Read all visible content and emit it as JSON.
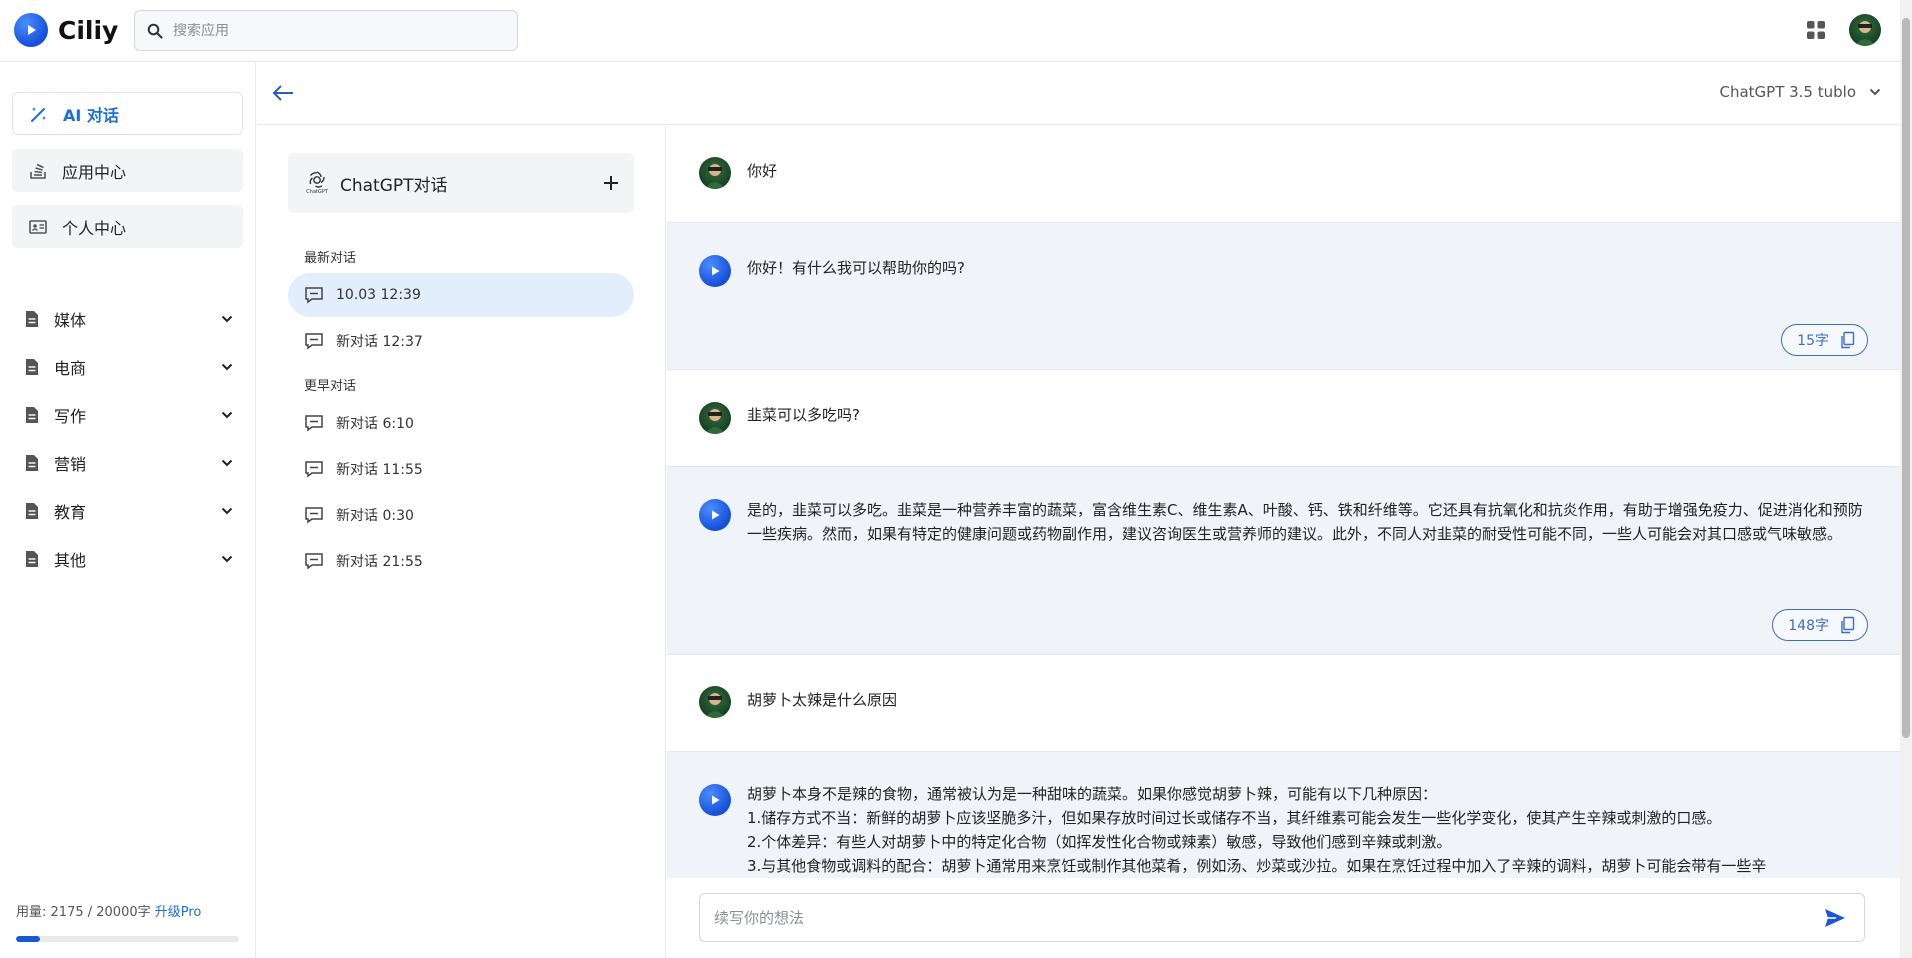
{
  "app": {
    "name": "Ciliy"
  },
  "search": {
    "placeholder": "搜索应用",
    "value": ""
  },
  "sidebar": {
    "nav": [
      {
        "label": "AI 对话",
        "icon": "magic-wand-icon",
        "active": true
      },
      {
        "label": "应用中心",
        "icon": "stack-icon",
        "active": false
      },
      {
        "label": "个人中心",
        "icon": "id-card-icon",
        "active": false
      }
    ],
    "categories": [
      {
        "label": "媒体"
      },
      {
        "label": "电商"
      },
      {
        "label": "写作"
      },
      {
        "label": "营销"
      },
      {
        "label": "教育"
      },
      {
        "label": "其他"
      }
    ],
    "usage": {
      "label": "用量:",
      "used": 2175,
      "total": 20000,
      "text": "2175 / 20000字",
      "upgrade": "升级Pro"
    }
  },
  "header": {
    "model": "ChatGPT 3.5 tublo"
  },
  "conversations": {
    "title": "ChatGPT对话",
    "logo_caption": "ChatGPT",
    "groups": [
      {
        "label": "最新对话",
        "items": [
          {
            "label": "10.03 12:39",
            "active": true
          },
          {
            "label": "新对话 12:37",
            "active": false
          }
        ]
      },
      {
        "label": "更早对话",
        "items": [
          {
            "label": "新对话 6:10"
          },
          {
            "label": "新对话 11:55"
          },
          {
            "label": "新对话 0:30"
          },
          {
            "label": "新对话 21:55"
          }
        ]
      }
    ]
  },
  "messages": [
    {
      "role": "user",
      "text": "你好"
    },
    {
      "role": "ai",
      "text": "你好！有什么我可以帮助你的吗?",
      "count": "15字"
    },
    {
      "role": "user",
      "text": "韭菜可以多吃吗?"
    },
    {
      "role": "ai",
      "text": "是的，韭菜可以多吃。韭菜是一种营养丰富的蔬菜，富含维生素C、维生素A、叶酸、钙、铁和纤维等。它还具有抗氧化和抗炎作用，有助于增强免疫力、促进消化和预防一些疾病。然而，如果有特定的健康问题或药物副作用，建议咨询医生或营养师的建议。此外，不同人对韭菜的耐受性可能不同，一些人可能会对其口感或气味敏感。",
      "count": "148字"
    },
    {
      "role": "user",
      "text": "胡萝卜太辣是什么原因"
    },
    {
      "role": "ai",
      "lines": [
        "胡萝卜本身不是辣的食物，通常被认为是一种甜味的蔬菜。如果你感觉胡萝卜辣，可能有以下几种原因：",
        "1.储存方式不当：新鲜的胡萝卜应该坚脆多汁，但如果存放时间过长或储存不当，其纤维素可能会发生一些化学变化，使其产生辛辣或刺激的口感。",
        "2.个体差异：有些人对胡萝卜中的特定化合物（如挥发性化合物或辣素）敏感，导致他们感到辛辣或刺激。",
        "3.与其他食物或调料的配合：胡萝卜通常用来烹饪或制作其他菜肴，例如汤、炒菜或沙拉。如果在烹饪过程中加入了辛辣的调料，胡萝卜可能会带有一些辛"
      ]
    }
  ],
  "input": {
    "placeholder": "续写你的想法",
    "value": ""
  },
  "colors": {
    "accent": "#1b6fd8",
    "ai_bg": "#f0f3f8",
    "active_conv": "#e3eefc"
  }
}
